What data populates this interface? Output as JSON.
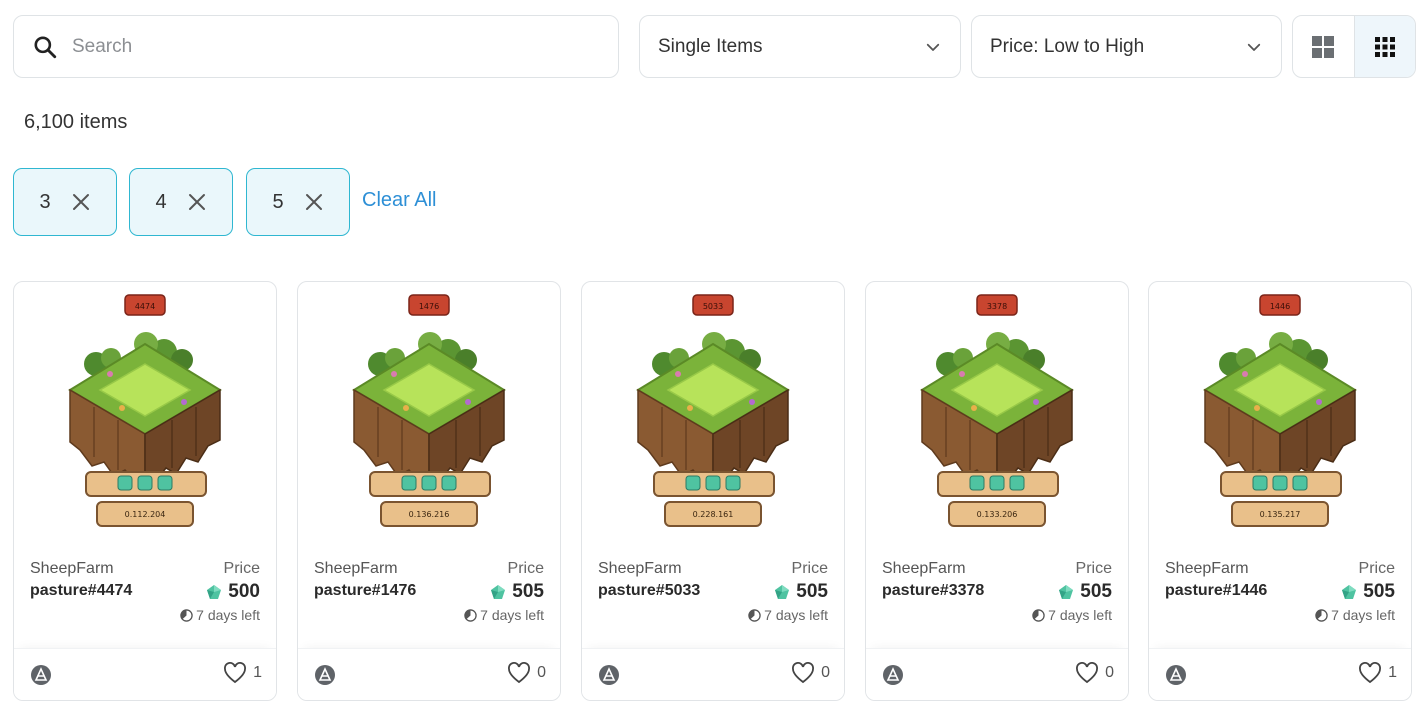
{
  "search": {
    "placeholder": "Search",
    "value": ""
  },
  "filters": {
    "type_select": "Single Items",
    "sort_select": "Price: Low to High"
  },
  "result_count": "6,100 items",
  "chips": [
    {
      "label": "3"
    },
    {
      "label": "4"
    },
    {
      "label": "5"
    }
  ],
  "clear_all": "Clear All",
  "price_label": "Price",
  "cards": [
    {
      "id_badge": "4474",
      "coords": "0.112.204",
      "collection": "SheepFarm",
      "name": "pasture#4474",
      "price": "500",
      "time_left": "7 days left",
      "likes": "1"
    },
    {
      "id_badge": "1476",
      "coords": "0.136.216",
      "collection": "SheepFarm",
      "name": "pasture#1476",
      "price": "505",
      "time_left": "7 days left",
      "likes": "0"
    },
    {
      "id_badge": "5033",
      "coords": "0.228.161",
      "collection": "SheepFarm",
      "name": "pasture#5033",
      "price": "505",
      "time_left": "7 days left",
      "likes": "0"
    },
    {
      "id_badge": "3378",
      "coords": "0.133.206",
      "collection": "SheepFarm",
      "name": "pasture#3378",
      "price": "505",
      "time_left": "7 days left",
      "likes": "0"
    },
    {
      "id_badge": "1446",
      "coords": "0.135.217",
      "collection": "SheepFarm",
      "name": "pasture#1446",
      "price": "505",
      "time_left": "7 days left",
      "likes": "1"
    }
  ],
  "icons": {
    "search": "search-icon",
    "chevron": "chevron-down-icon",
    "grid_large": "grid-large-icon",
    "grid_small": "grid-small-icon",
    "chip_remove": "close-icon",
    "currency": "gem-icon",
    "timer": "clock-icon",
    "heart": "heart-icon",
    "chain": "chain-logo-icon"
  },
  "colors": {
    "accent": "#2d8fd6",
    "chip_border": "#2fb7d1",
    "chip_bg": "#eaf7fb",
    "gem": "#4fc3a1",
    "badge_red": "#c8452f",
    "sign_tan": "#e9c08a"
  }
}
